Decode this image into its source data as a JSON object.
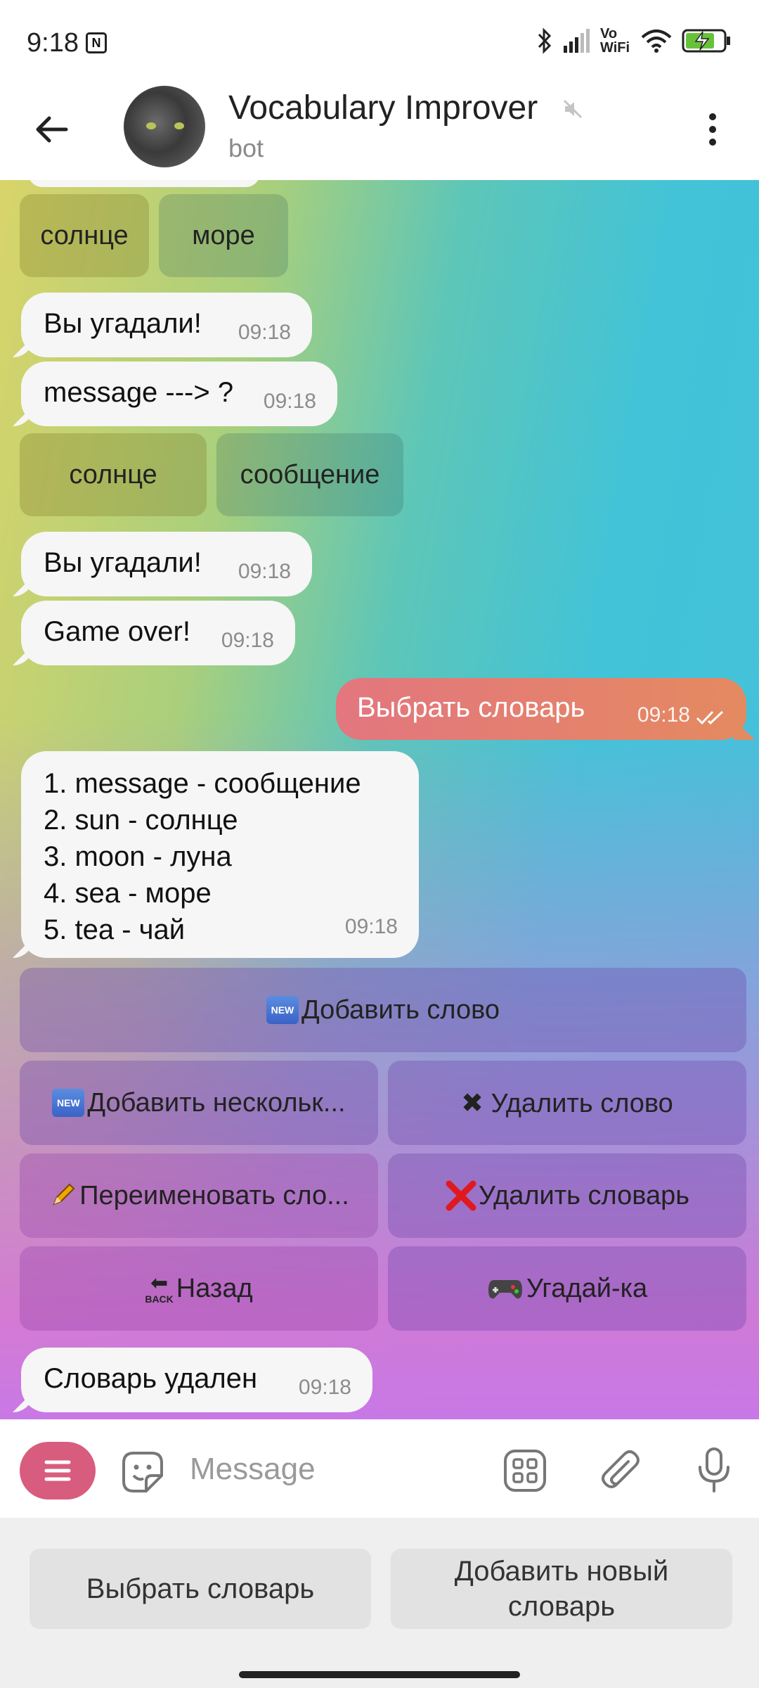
{
  "status_bar": {
    "time": "9:18",
    "icons": [
      "nfc-icon",
      "bluetooth-icon",
      "signal-icon",
      "vowifi-icon",
      "wifi-icon",
      "battery-charging-icon"
    ],
    "vowifi_label": "Vo\nWiFi"
  },
  "header": {
    "title": "Vocabulary Improver",
    "subtitle": "bot",
    "icons": [
      "back-arrow-icon",
      "avatar",
      "muted-icon",
      "more-vertical-icon"
    ]
  },
  "chat": {
    "keyboard_1": [
      "солнце",
      "море"
    ],
    "msg_1": {
      "text": "Вы угадали!",
      "time": "09:18"
    },
    "msg_2": {
      "text": "message ---> ?",
      "time": "09:18"
    },
    "keyboard_2": [
      "солнце",
      "сообщение"
    ],
    "msg_3": {
      "text": "Вы угадали!",
      "time": "09:18"
    },
    "msg_4": {
      "text": "Game over!",
      "time": "09:18"
    },
    "outgoing_1": {
      "text": "Выбрать словарь",
      "time": "09:18"
    },
    "dict_list": {
      "items": [
        "1. message - сообщение",
        "2. sun - солнце",
        "3. moon - луна",
        "4. sea - море",
        "5. tea - чай"
      ],
      "time": "09:18"
    },
    "actions": {
      "add_word": "Добавить слово",
      "add_several": "Добавить нескольк...",
      "delete_word": "✖ Удалить слово",
      "rename": "Переименовать сло...",
      "delete_dict": "Удалить словарь",
      "back": "Назад",
      "guess": "Угадай-ка",
      "new_badge": "NEW",
      "back_badge": "BACK"
    },
    "msg_5": {
      "text": "Словарь удален",
      "time": "09:18"
    }
  },
  "input": {
    "placeholder": "Message",
    "icons": [
      "menu-icon",
      "sticker-icon",
      "apps-icon",
      "attach-icon",
      "mic-icon"
    ]
  },
  "reply_keyboard": {
    "left": "Выбрать словарь",
    "right_line1": "Добавить новый",
    "right_line2": "словарь"
  }
}
